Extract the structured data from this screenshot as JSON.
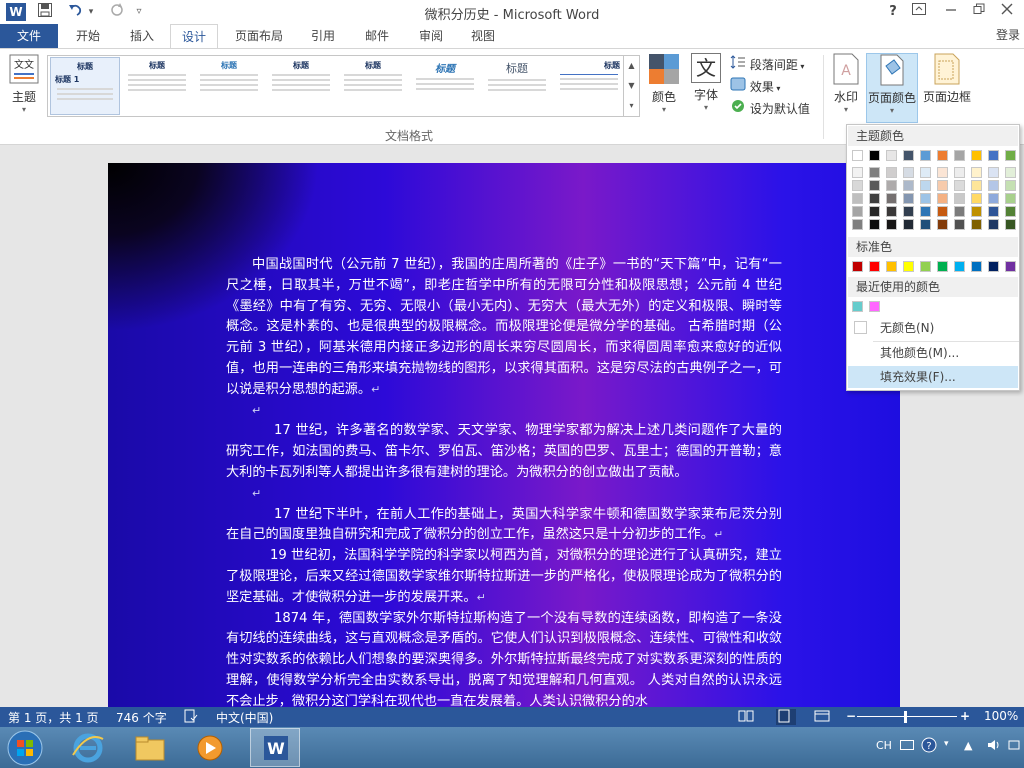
{
  "window": {
    "title": "微积分历史 - Microsoft Word",
    "app_icon": "W",
    "login": "登录",
    "help": "?"
  },
  "quick_access": {
    "save": "save-icon",
    "undo": "undo-icon",
    "redo": "redo-icon",
    "customize": "customize-icon"
  },
  "tabs": [
    {
      "label": "文件"
    },
    {
      "label": "开始"
    },
    {
      "label": "插入"
    },
    {
      "label": "设计"
    },
    {
      "label": "页面布局"
    },
    {
      "label": "引用"
    },
    {
      "label": "邮件"
    },
    {
      "label": "审阅"
    },
    {
      "label": "视图"
    }
  ],
  "ribbon": {
    "theme_label": "主题",
    "group_label": "文档格式",
    "colors_label": "颜色",
    "fonts_label": "字体",
    "paragraph_spacing": "段落间距",
    "effects": "效果",
    "set_default": "设为默认值",
    "watermark": "水印",
    "page_color": "页面颜色",
    "page_borders": "页面边框",
    "style_items": [
      "标题",
      "标题",
      "标题",
      "标题",
      "标题",
      "标题",
      "标题",
      "标题"
    ],
    "style_first": "标题 1"
  },
  "page_color_menu": {
    "theme_colors_header": "主题颜色",
    "standard_colors_header": "标准色",
    "recent_colors_header": "最近使用的颜色",
    "no_color": "无颜色(N)",
    "more_colors": "其他颜色(M)...",
    "fill_effects": "填充效果(F)...",
    "theme_top_row": [
      "#ffffff",
      "#000000",
      "#e7e6e6",
      "#44546a",
      "#5b9bd5",
      "#ed7d31",
      "#a5a5a5",
      "#ffc000",
      "#4472c4",
      "#70ad47"
    ],
    "theme_shades": [
      [
        "#f2f2f2",
        "#7f7f7f",
        "#d0cece",
        "#d6dce4",
        "#deebf6",
        "#fbe5d5",
        "#ededed",
        "#fff2cc",
        "#dae3f3",
        "#e2efd9"
      ],
      [
        "#d8d8d8",
        "#595959",
        "#aeabab",
        "#adb9ca",
        "#bdd7ee",
        "#f7cbac",
        "#dbdbdb",
        "#fee599",
        "#b4c6e7",
        "#c5e0b3"
      ],
      [
        "#bfbfbf",
        "#3f3f3f",
        "#757070",
        "#8496b0",
        "#9dc3e6",
        "#f4b183",
        "#c9c9c9",
        "#ffd965",
        "#8faadc",
        "#a8d08d"
      ],
      [
        "#a5a5a5",
        "#262626",
        "#3a3838",
        "#323f4f",
        "#2e75b5",
        "#c55a11",
        "#7b7b7b",
        "#bf9000",
        "#2f5597",
        "#538135"
      ],
      [
        "#7f7f7f",
        "#0c0c0c",
        "#171616",
        "#222a35",
        "#1e4e79",
        "#833c0b",
        "#525252",
        "#7f6000",
        "#1f3864",
        "#375623"
      ]
    ],
    "standard": [
      "#c00000",
      "#ff0000",
      "#ffc000",
      "#ffff00",
      "#92d050",
      "#00b050",
      "#00b0f0",
      "#0070c0",
      "#002060",
      "#7030a0"
    ],
    "recent": [
      "#66cccc",
      "#ff66ff"
    ]
  },
  "document": {
    "paragraphs": [
      "中国战国时代（公元前 7 世纪），我国的庄周所著的《庄子》一书的“天下篇”中，记有“一尺之棰，日取其半，万世不竭”，即老庄哲学中所有的无限可分性和极限思想；公元前 4 世纪《墨经》中有了有穷、无穷、无限小（最小无内）、无穷大（最大无外）的定义和极限、瞬时等概念。这是朴素的、也是很典型的极限概念。而极限理论便是微分学的基础。   古希腊时期（公元前 3 世纪），阿基米德用内接正多边形的周长来穷尽圆周长，而求得圆周率愈来愈好的近似值，也用一连串的三角形来填充抛物线的图形，以求得其面积。这是穷尽法的古典例子之一，可以说是积分思想的起源。",
      "",
      "17 世纪，许多著名的数学家、天文学家、物理学家都为解决上述几类问题作了大量的研究工作，如法国的费马、笛卡尔、罗伯瓦、笛沙格；英国的巴罗、瓦里士；德国的开普勒；意大利的卡瓦列利等人都提出许多很有建树的理论。为微积分的创立做出了贡献。",
      "",
      "17 世纪下半叶，在前人工作的基础上，英国大科学家牛顿和德国数学家莱布尼茨分别在自己的国度里独自研究和完成了微积分的创立工作，虽然这只是十分初步的工作。",
      "19 世纪初，法国科学学院的科学家以柯西为首，对微积分的理论进行了认真研究，建立了极限理论，后来又经过德国数学家维尔斯特拉斯进一步的严格化，使极限理论成为了微积分的坚定基础。才使微积分进一步的发展开来。",
      "1874 年，德国数学家外尔斯特拉斯构造了一个没有导数的连续函数，即构造了一条没有切线的连续曲线，这与直观概念是矛盾的。它使人们认识到极限概念、连续性、可微性和收敛性对实数系的依赖比人们想象的要深奥得多。外尔斯特拉斯最终完成了对实数系更深刻的性质的理解，使得数学分析完全由实数系导出，脱离了知觉理解和几何直观。   人类对自然的认识永远不会止步，微积分这门学科在现代也一直在发展着。人类认识微积分的水"
    ]
  },
  "status": {
    "page": "第 1 页，共 1 页",
    "words": "746 个字",
    "lang": "中文(中国)",
    "zoom": "100%"
  },
  "taskbar": {
    "ime": "CH"
  }
}
